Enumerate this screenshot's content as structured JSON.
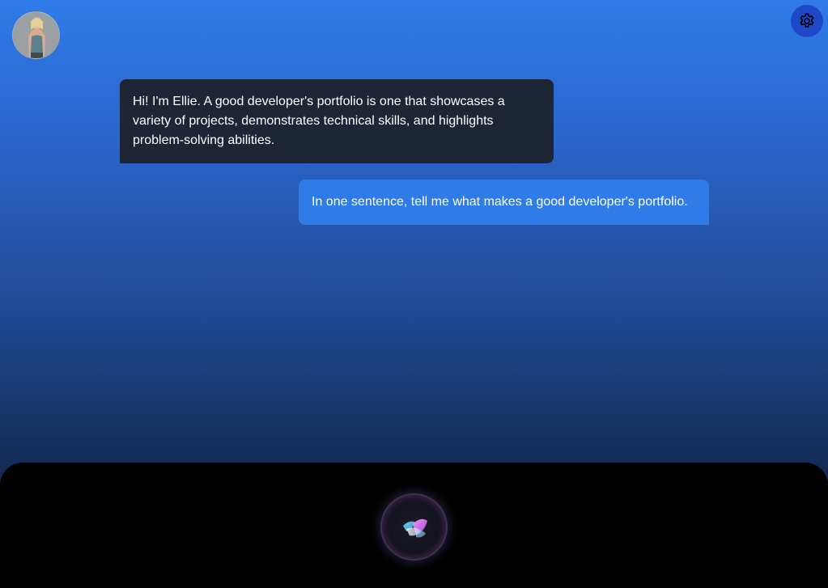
{
  "header": {
    "avatar_alt": "Ellie avatar",
    "settings_label": "Settings"
  },
  "conversation": {
    "messages": [
      {
        "role": "assistant",
        "text": "Hi! I'm Ellie. A good developer's portfolio is one that showcases a variety of projects, demonstrates technical skills, and highlights problem-solving abilities."
      },
      {
        "role": "user",
        "text": "In one sentence, tell me what makes a good developer's portfolio."
      }
    ]
  },
  "footer": {
    "voice_button_label": "Voice input"
  },
  "colors": {
    "user_bubble": "#2f7be8",
    "assistant_bubble": "#1e2535",
    "settings_button": "#1d49c9",
    "panel": "#000000"
  }
}
